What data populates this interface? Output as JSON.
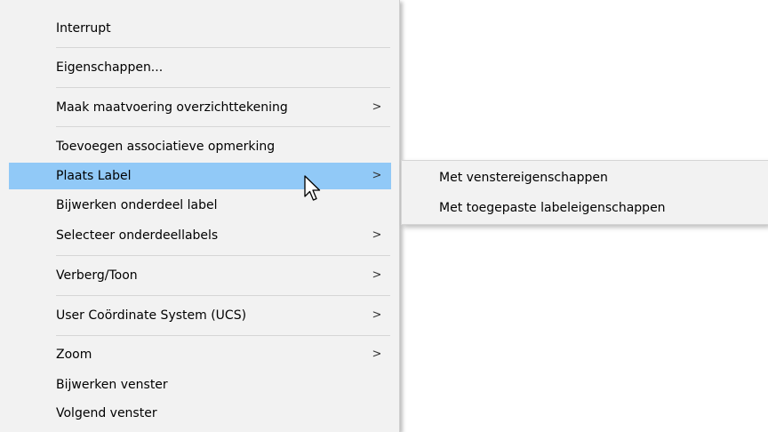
{
  "menu": {
    "items": [
      {
        "label": "Interrupt",
        "submenu": false
      },
      {
        "label": "Eigenschappen...",
        "submenu": false
      },
      {
        "label": "Maak maatvoering overzichttekening",
        "submenu": true
      },
      {
        "label": "Toevoegen associatieve opmerking",
        "submenu": false
      },
      {
        "label": "Plaats Label",
        "submenu": true,
        "highlighted": true
      },
      {
        "label": "Bijwerken onderdeel label",
        "submenu": false
      },
      {
        "label": "Selecteer onderdeellabels",
        "submenu": true
      },
      {
        "label": "Verberg/Toon",
        "submenu": true
      },
      {
        "label": "User Coördinate System (UCS)",
        "submenu": true
      },
      {
        "label": "Zoom",
        "submenu": true
      },
      {
        "label": "Bijwerken venster",
        "submenu": false
      },
      {
        "label": "Volgend venster",
        "submenu": false
      }
    ],
    "arrow_glyph": ">"
  },
  "submenu": {
    "items": [
      {
        "label": "Met venstereigenschappen"
      },
      {
        "label": "Met toegepaste labeleigenschappen"
      }
    ]
  },
  "colors": {
    "menu_background": "#f2f2f2",
    "highlight": "#91c9f7",
    "separator": "#d6d6d6"
  },
  "cursor": {
    "icon": "arrow-pointer-icon"
  }
}
